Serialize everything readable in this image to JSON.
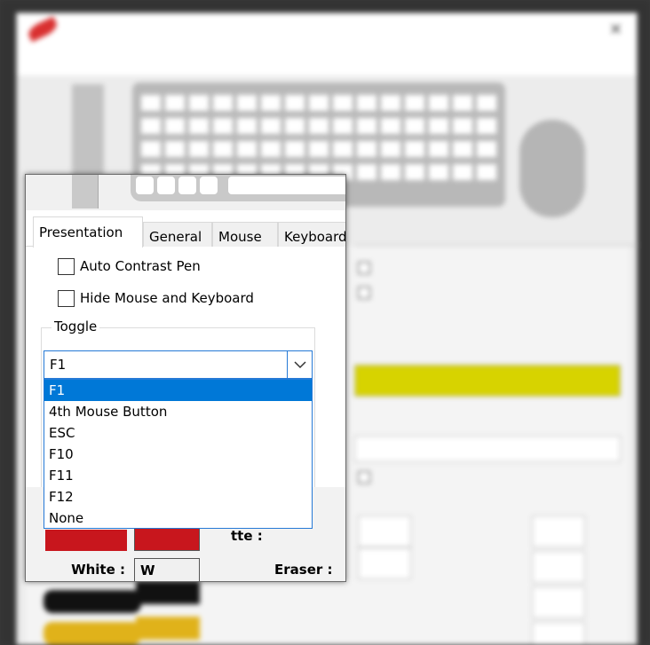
{
  "foreground": {
    "tabs": [
      {
        "label": "Presentation",
        "active": true
      },
      {
        "label": "General",
        "active": false
      },
      {
        "label": "Mouse",
        "active": false
      },
      {
        "label": "Keyboard",
        "active": false
      }
    ],
    "checkboxes": [
      {
        "label": "Auto Contrast Pen",
        "checked": false
      },
      {
        "label": "Hide Mouse and Keyboard",
        "checked": false
      }
    ],
    "toggle_group_label": "Toggle",
    "toggle_select": {
      "value": "F1",
      "options": [
        "F1",
        "4th Mouse Button",
        "ESC",
        "F10",
        "F11",
        "F12",
        "None"
      ]
    },
    "colors": {
      "white_label": "White :",
      "white_key": "W",
      "palette_label": "tte :",
      "eraser_label": "Eraser :",
      "red": "#c8161d",
      "black": "#111111",
      "accent": "#0078d7"
    }
  }
}
